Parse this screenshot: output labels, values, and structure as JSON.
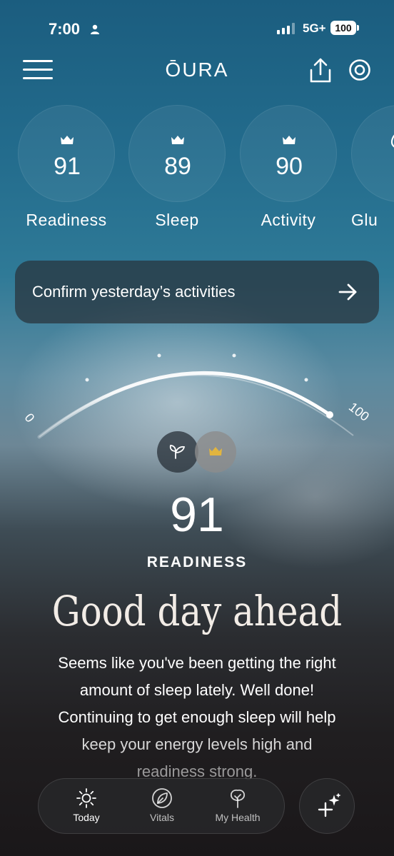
{
  "status_bar": {
    "time": "7:00",
    "network": "5G+",
    "battery": "100"
  },
  "header": {
    "brand": "ŌURA"
  },
  "scores": [
    {
      "value": "91",
      "label": "Readiness"
    },
    {
      "value": "89",
      "label": "Sleep"
    },
    {
      "value": "90",
      "label": "Activity"
    },
    {
      "value": "",
      "label": "Glu"
    }
  ],
  "confirm_card": {
    "text": "Confirm yesterday’s activities"
  },
  "gauge": {
    "min_label": "0",
    "max_label": "100",
    "value": 91
  },
  "readiness": {
    "score": "91",
    "label": "READINESS",
    "headline": "Good day ahead",
    "body_lines": [
      "Seems like you've been getting the right",
      "amount of sleep lately. Well done!",
      "Continuing to get enough sleep will help",
      "keep your energy levels high and",
      "readiness strong."
    ]
  },
  "tabbar": {
    "tabs": [
      {
        "label": "Today",
        "icon": "sun-icon"
      },
      {
        "label": "Vitals",
        "icon": "leaf-icon"
      },
      {
        "label": "My Health",
        "icon": "tree-icon"
      }
    ],
    "fab_icon": "sparkle-plus-icon"
  }
}
